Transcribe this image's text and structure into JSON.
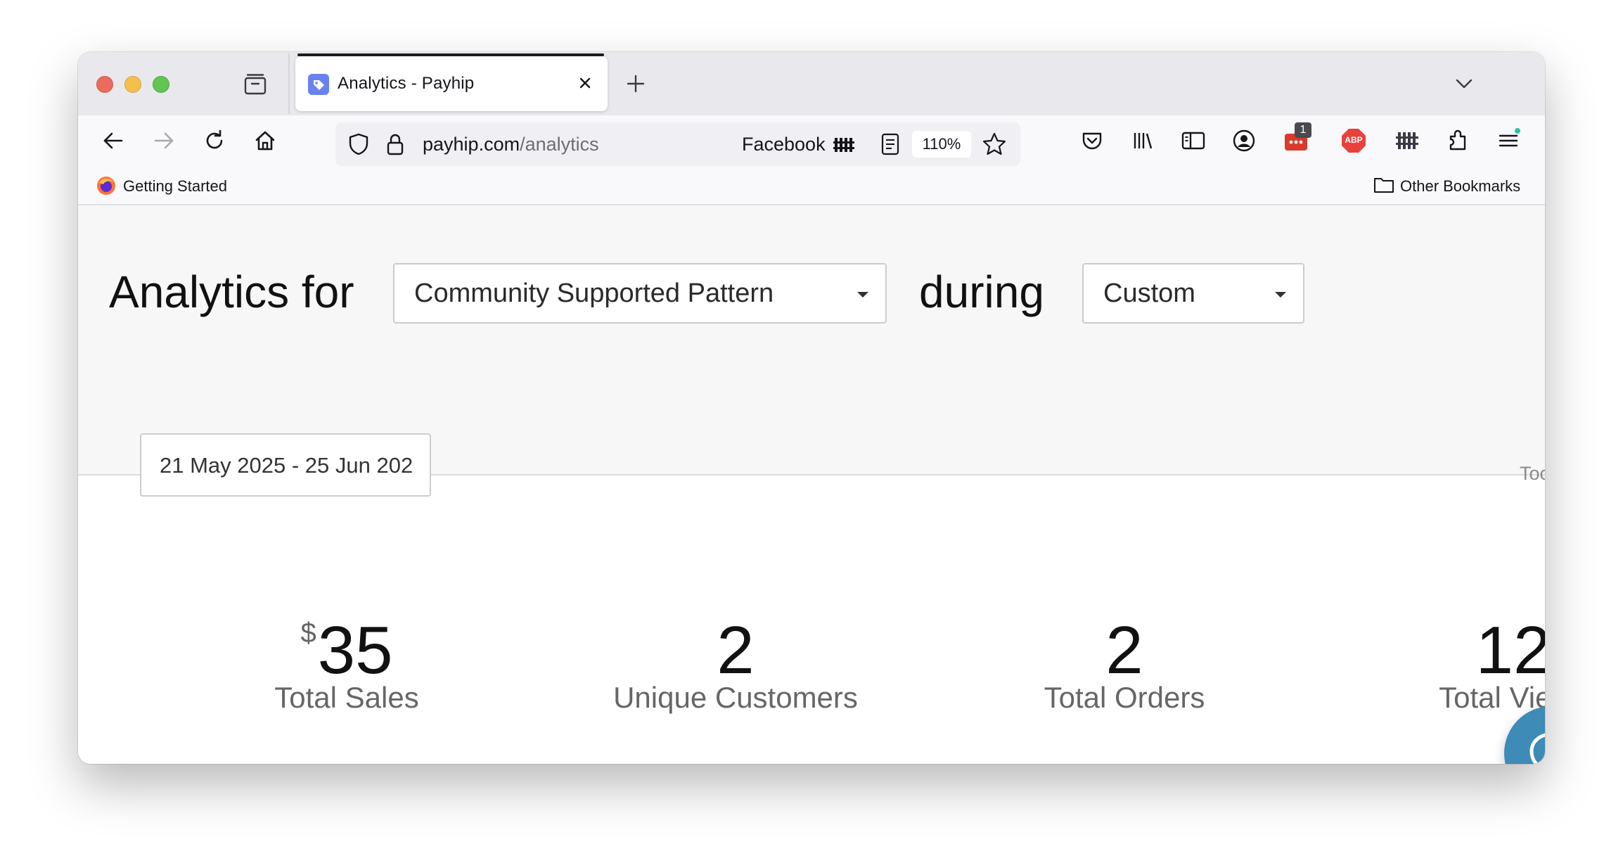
{
  "browser": {
    "tab": {
      "title": "Analytics - Payhip"
    },
    "url": {
      "domain": "payhip.com",
      "path": "/analytics"
    },
    "container_label": "Facebook",
    "zoom": "110%",
    "extension_badge": "1",
    "abp_label": "ABP",
    "bookmarks": {
      "left": "Getting Started",
      "right": "Other Bookmarks"
    },
    "colors": {
      "tab_favicon": "#6a82f0",
      "accent": "#3d8bb6"
    }
  },
  "page": {
    "analytics_for_label": "Analytics for",
    "product_select": {
      "value": "Community Supported Pattern"
    },
    "during_label": "during",
    "period_select": {
      "value": "Custom"
    },
    "date_range": "21 May 2025 - 25 Jun 202",
    "clipped_text": "Toc",
    "stats": [
      {
        "currency": "$",
        "value": "35",
        "label": "Total Sales"
      },
      {
        "value": "2",
        "label": "Unique Customers"
      },
      {
        "value": "2",
        "label": "Total Orders"
      },
      {
        "value": "12",
        "label": "Total Views"
      }
    ]
  }
}
